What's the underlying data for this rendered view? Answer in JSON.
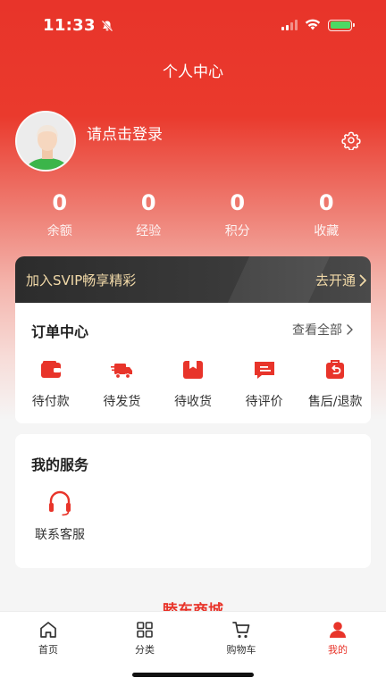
{
  "status_bar": {
    "time": "11:33"
  },
  "header": {
    "title": "个人中心"
  },
  "profile": {
    "login_prompt": "请点击登录"
  },
  "stats": [
    {
      "value": "0",
      "label": "余额"
    },
    {
      "value": "0",
      "label": "经验"
    },
    {
      "value": "0",
      "label": "积分"
    },
    {
      "value": "0",
      "label": "收藏"
    }
  ],
  "svip": {
    "text": "加入SVIP畅享精彩",
    "action": "去开通"
  },
  "orders": {
    "title": "订单中心",
    "view_all": "查看全部",
    "items": [
      {
        "label": "待付款",
        "icon": "wallet-icon"
      },
      {
        "label": "待发货",
        "icon": "truck-icon"
      },
      {
        "label": "待收货",
        "icon": "package-icon"
      },
      {
        "label": "待评价",
        "icon": "review-icon"
      },
      {
        "label": "售后/退款",
        "icon": "refund-icon"
      }
    ]
  },
  "services": {
    "title": "我的服务",
    "items": [
      {
        "label": "联系客服",
        "icon": "headset-icon"
      }
    ]
  },
  "peek_text": "睦东商城",
  "tabbar": [
    {
      "label": "首页",
      "icon": "home-icon",
      "active": false
    },
    {
      "label": "分类",
      "icon": "category-icon",
      "active": false
    },
    {
      "label": "购物车",
      "icon": "cart-icon",
      "active": false
    },
    {
      "label": "我的",
      "icon": "user-icon",
      "active": true
    }
  ],
  "colors": {
    "accent": "#e8342a",
    "svip_gold": "#f1d9a8",
    "svip_bg": "#2c2c2c"
  }
}
